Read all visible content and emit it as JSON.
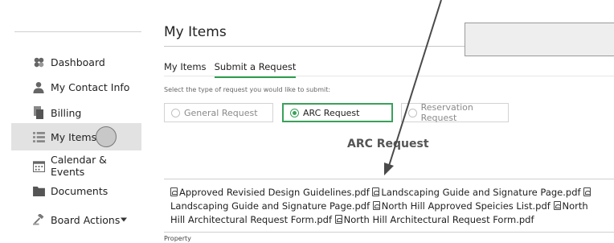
{
  "sidebar": {
    "items": [
      {
        "label": "Dashboard",
        "icon": "dashboard-icon"
      },
      {
        "label": "My Contact Info",
        "icon": "person-icon"
      },
      {
        "label": "Billing",
        "icon": "billing-icon"
      },
      {
        "label": "My Items",
        "icon": "list-icon",
        "active": true
      },
      {
        "label": "Calendar & Events",
        "icon": "calendar-icon"
      },
      {
        "label": "Documents",
        "icon": "folder-icon"
      },
      {
        "label": "Board Actions",
        "icon": "gavel-icon"
      }
    ]
  },
  "main": {
    "title": "My Items",
    "tabs": [
      {
        "label": "My Items"
      },
      {
        "label": "Submit a Request",
        "active": true
      }
    ],
    "prompt": "Select the type of request you would like to submit:",
    "request_types": [
      {
        "label": "General Request",
        "selected": false
      },
      {
        "label": "ARC Request",
        "selected": true
      },
      {
        "label": "Reservation Request",
        "selected": false
      }
    ],
    "section_heading": "ARC Request",
    "documents": [
      "Approved Revisied Design Guidelines.pdf",
      "Landscaping Guide and Signature Page.pdf",
      "Landscaping Guide and Signature Page.pdf",
      "North Hill Approved Speicies List.pdf",
      "North Hill Architectural Request Form.pdf",
      "North Hill Architectural Request Form.pdf"
    ],
    "property_label": "Property"
  },
  "colors": {
    "accent": "#3aa15a",
    "active_nav_bg": "#e2e2e2"
  }
}
